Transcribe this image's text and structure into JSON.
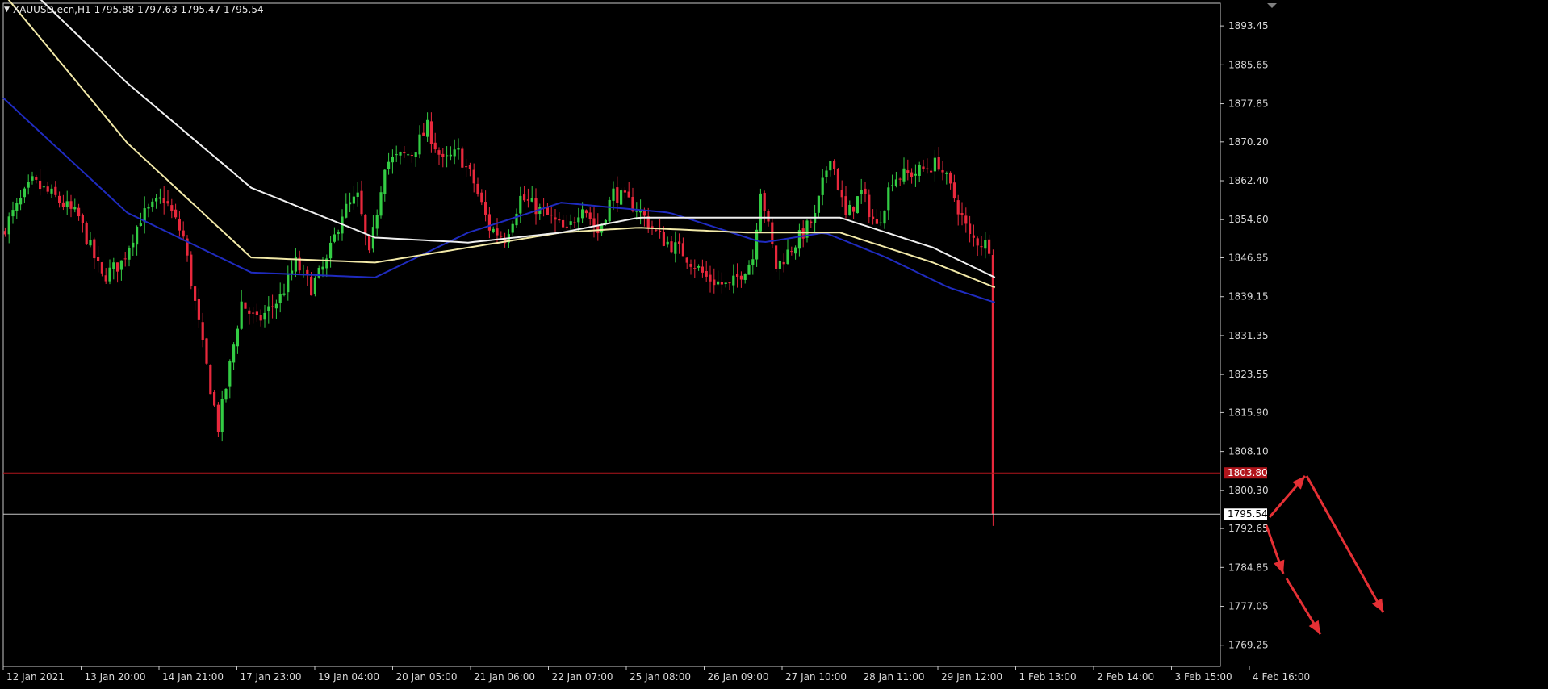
{
  "header": {
    "symbol_text": "XAUUSD.ecn,H1",
    "ohlc_text": "1795.88 1797.63 1795.47 1795.54"
  },
  "colors": {
    "background": "#000000",
    "bull": "#33cc44",
    "bear": "#e8283c",
    "ma_blue": "#1f2bbf",
    "ma_yellow": "#f2e9a8",
    "ma_white": "#f0f0f0",
    "resistance_line": "#b0151c",
    "current_price_line": "#c8c8c8",
    "arrow": "#e53035",
    "axis": "#c8c8c8"
  },
  "chart_data": {
    "type": "candlestick",
    "symbol": "XAUUSD.ecn",
    "timeframe": "H1",
    "ylim": [
      1765.0,
      1898.0
    ],
    "y_ticks": [
      "1893.45",
      "1885.65",
      "1877.85",
      "1870.20",
      "1862.40",
      "1854.60",
      "1846.95",
      "1839.15",
      "1831.35",
      "1823.55",
      "1815.90",
      "1808.10",
      "1800.30",
      "1792.65",
      "1784.85",
      "1777.05",
      "1769.25"
    ],
    "x_ticks": [
      "12 Jan 2021",
      "13 Jan 20:00",
      "14 Jan 21:00",
      "17 Jan 23:00",
      "19 Jan 04:00",
      "20 Jan 05:00",
      "21 Jan 06:00",
      "22 Jan 07:00",
      "25 Jan 08:00",
      "26 Jan 09:00",
      "27 Jan 10:00",
      "28 Jan 11:00",
      "29 Jan 12:00",
      "1 Feb 13:00",
      "2 Feb 14:00",
      "3 Feb 15:00",
      "4 Feb 16:00"
    ],
    "bar_count": 256,
    "price_anchors": [
      [
        0,
        1852
      ],
      [
        8,
        1862
      ],
      [
        14,
        1859
      ],
      [
        20,
        1855
      ],
      [
        26,
        1843
      ],
      [
        31,
        1846
      ],
      [
        36,
        1855
      ],
      [
        42,
        1859
      ],
      [
        47,
        1851
      ],
      [
        52,
        1829
      ],
      [
        56,
        1813
      ],
      [
        58,
        1821
      ],
      [
        62,
        1838
      ],
      [
        66,
        1834
      ],
      [
        72,
        1839
      ],
      [
        76,
        1846
      ],
      [
        80,
        1841
      ],
      [
        84,
        1846
      ],
      [
        88,
        1856
      ],
      [
        92,
        1859
      ],
      [
        95,
        1847
      ],
      [
        99,
        1866
      ],
      [
        106,
        1868
      ],
      [
        110,
        1873
      ],
      [
        114,
        1866
      ],
      [
        118,
        1868
      ],
      [
        122,
        1862
      ],
      [
        126,
        1853
      ],
      [
        130,
        1851
      ],
      [
        134,
        1859
      ],
      [
        140,
        1856
      ],
      [
        146,
        1852
      ],
      [
        150,
        1858
      ],
      [
        154,
        1852
      ],
      [
        158,
        1860
      ],
      [
        164,
        1857
      ],
      [
        170,
        1851
      ],
      [
        176,
        1848
      ],
      [
        182,
        1843
      ],
      [
        188,
        1841
      ],
      [
        194,
        1847
      ],
      [
        196,
        1861
      ],
      [
        200,
        1845
      ],
      [
        204,
        1849
      ],
      [
        210,
        1855
      ],
      [
        214,
        1868
      ],
      [
        218,
        1855
      ],
      [
        222,
        1860
      ],
      [
        226,
        1853
      ],
      [
        230,
        1863
      ],
      [
        236,
        1864
      ],
      [
        242,
        1866
      ],
      [
        246,
        1859
      ],
      [
        250,
        1851
      ],
      [
        256,
        1849
      ],
      [
        262,
        1838
      ],
      [
        266,
        1840
      ],
      [
        272,
        1842
      ],
      [
        278,
        1839
      ],
      [
        284,
        1841
      ],
      [
        290,
        1834
      ],
      [
        294,
        1828
      ],
      [
        298,
        1822
      ],
      [
        302,
        1822
      ],
      [
        306,
        1818
      ],
      [
        309,
        1811
      ],
      [
        311,
        1790
      ],
      [
        314,
        1788
      ],
      [
        318,
        1792
      ],
      [
        320,
        1795.54
      ]
    ],
    "moving_averages": [
      {
        "color_key": "ma_blue",
        "points": [
          [
            0,
            1879
          ],
          [
            40,
            1856
          ],
          [
            80,
            1844
          ],
          [
            120,
            1843
          ],
          [
            150,
            1852
          ],
          [
            180,
            1858
          ],
          [
            215,
            1856
          ],
          [
            245,
            1850
          ],
          [
            265,
            1852
          ],
          [
            285,
            1847
          ],
          [
            305,
            1841
          ],
          [
            320,
            1838
          ]
        ]
      },
      {
        "color_key": "ma_yellow",
        "points": [
          [
            0,
            1900
          ],
          [
            40,
            1870
          ],
          [
            80,
            1847
          ],
          [
            120,
            1846
          ],
          [
            150,
            1849
          ],
          [
            180,
            1852
          ],
          [
            205,
            1853
          ],
          [
            240,
            1852
          ],
          [
            270,
            1852
          ],
          [
            300,
            1846
          ],
          [
            320,
            1841
          ]
        ]
      },
      {
        "color_key": "ma_white",
        "points": [
          [
            0,
            1906
          ],
          [
            40,
            1882
          ],
          [
            80,
            1861
          ],
          [
            120,
            1851
          ],
          [
            150,
            1850
          ],
          [
            180,
            1852
          ],
          [
            205,
            1855
          ],
          [
            240,
            1855
          ],
          [
            270,
            1855
          ],
          [
            300,
            1849
          ],
          [
            320,
            1843
          ]
        ]
      }
    ],
    "levels": {
      "resistance": 1803.8,
      "current_price": 1795.54
    },
    "resistance_label": "1803.80",
    "current_price_label": "1795.54"
  }
}
